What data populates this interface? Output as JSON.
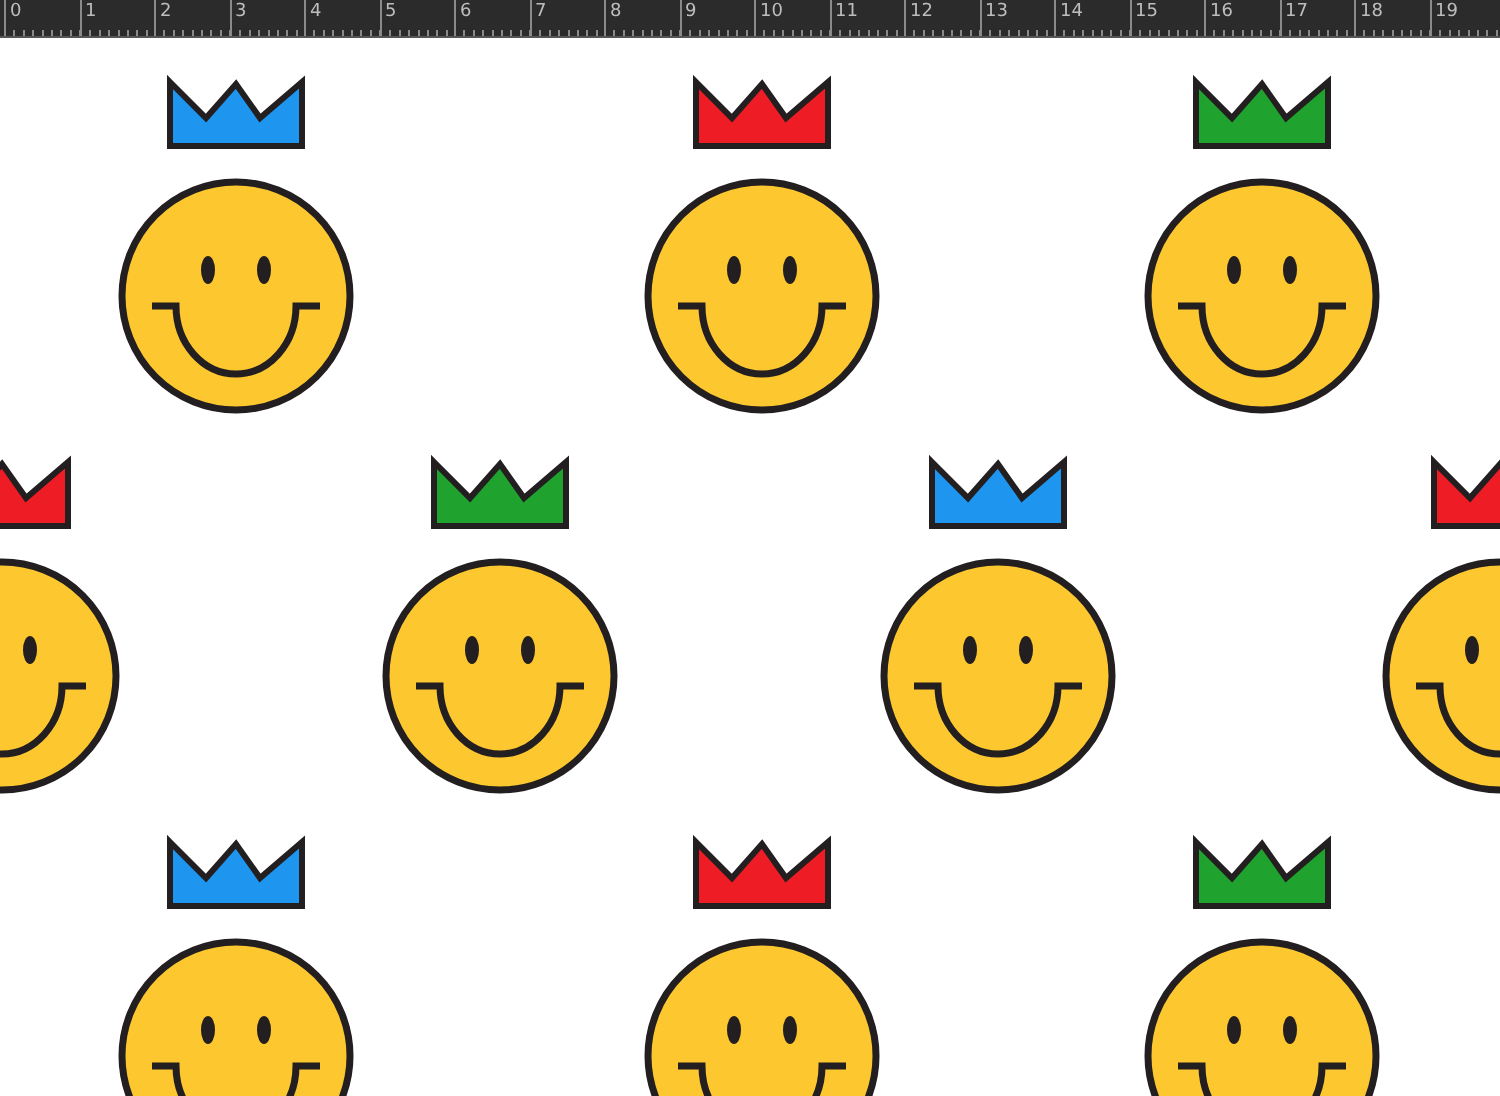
{
  "ruler": {
    "labels": [
      "0",
      "1",
      "2",
      "3",
      "4",
      "5",
      "6",
      "7",
      "8",
      "9",
      "10",
      "11",
      "12",
      "13",
      "14",
      "15",
      "16",
      "17",
      "18",
      "19"
    ]
  },
  "pattern": {
    "faces": [
      {
        "color": "#1e96f0"
      },
      {
        "color": "#ee1c25"
      },
      {
        "color": "#1fa22e"
      },
      {
        "color": "#ee1c25"
      },
      {
        "color": "#1fa22e"
      },
      {
        "color": "#1e96f0"
      },
      {
        "color": "#ee1c25"
      },
      {
        "color": "#1e96f0"
      },
      {
        "color": "#ee1c25"
      },
      {
        "color": "#1fa22e"
      }
    ]
  }
}
